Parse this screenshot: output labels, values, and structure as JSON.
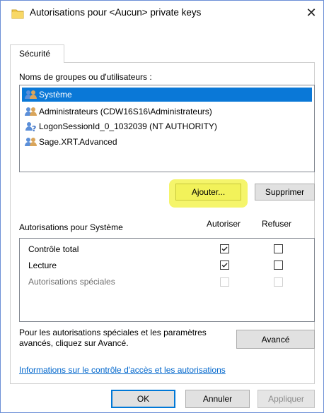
{
  "window": {
    "title": "Autorisations pour <Aucun> private keys",
    "close_glyph": "✕"
  },
  "tabs": [
    {
      "label": "Sécurité",
      "active": true
    }
  ],
  "groups": {
    "label": "Noms de groupes ou d'utilisateurs :",
    "items": [
      {
        "label": "Système",
        "icon": "users-icon",
        "selected": true
      },
      {
        "label": "Administrateurs (CDW16S16\\Administrateurs)",
        "icon": "users-icon",
        "selected": false
      },
      {
        "label": "LogonSessionId_0_1032039 (NT AUTHORITY)",
        "icon": "unknown-user-icon",
        "selected": false
      },
      {
        "label": "Sage.XRT.Advanced",
        "icon": "users-icon",
        "selected": false
      }
    ],
    "add_button": "Ajouter...",
    "remove_button": "Supprimer"
  },
  "permissions": {
    "title": "Autorisations pour Système",
    "allow_header": "Autoriser",
    "deny_header": "Refuser",
    "rows": [
      {
        "label": "Contrôle total",
        "allow": true,
        "deny": false,
        "enabled": true
      },
      {
        "label": "Lecture",
        "allow": true,
        "deny": false,
        "enabled": true
      },
      {
        "label": "Autorisations spéciales",
        "allow": false,
        "deny": false,
        "enabled": false
      }
    ]
  },
  "advanced": {
    "text": "Pour les autorisations spéciales et les paramètres avancés, cliquez sur Avancé.",
    "button": "Avancé"
  },
  "link": "Informations sur le contrôle d'accès et les autorisations",
  "footer": {
    "ok": "OK",
    "cancel": "Annuler",
    "apply": "Appliquer"
  },
  "colors": {
    "selection": "#0a78d7",
    "highlight": "#f5f56b",
    "link": "#0066cc"
  }
}
